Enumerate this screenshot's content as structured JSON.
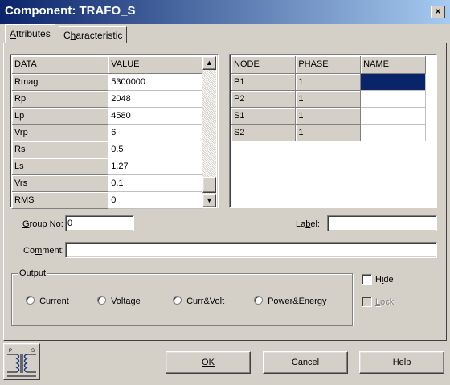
{
  "window": {
    "title": "Component: TRAFO_S",
    "close_label": "×"
  },
  "tabs": [
    {
      "label": "Attributes",
      "active": true
    },
    {
      "label": "Characteristic",
      "active": false
    }
  ],
  "data_grid": {
    "columns": [
      "DATA",
      "VALUE"
    ],
    "rows": [
      {
        "name": "Rmag",
        "value": "5300000"
      },
      {
        "name": "Rp",
        "value": "2048"
      },
      {
        "name": "Lp",
        "value": "4580"
      },
      {
        "name": "Vrp",
        "value": "6"
      },
      {
        "name": "Rs",
        "value": "0.5"
      },
      {
        "name": "Ls",
        "value": "1.27"
      },
      {
        "name": "Vrs",
        "value": "0.1"
      },
      {
        "name": "RMS",
        "value": "0"
      }
    ]
  },
  "node_grid": {
    "columns": [
      "NODE",
      "PHASE",
      "NAME"
    ],
    "rows": [
      {
        "node": "P1",
        "phase": "1",
        "name": ""
      },
      {
        "node": "P2",
        "phase": "1",
        "name": ""
      },
      {
        "node": "S1",
        "phase": "1",
        "name": ""
      },
      {
        "node": "S2",
        "phase": "1",
        "name": ""
      }
    ],
    "selection_color": "#0a246a"
  },
  "group_no": {
    "label": "Group No:",
    "value": "0"
  },
  "label_field": {
    "label": "Label:",
    "value": ""
  },
  "comment_field": {
    "label": "Comment:",
    "value": ""
  },
  "output": {
    "legend": "Output",
    "options": [
      "Current",
      "Voltage",
      "Curr&Volt",
      "Power&Energy"
    ]
  },
  "hide": {
    "label": "Hide",
    "checked": false
  },
  "lock": {
    "label": "Lock",
    "checked": false,
    "disabled": true
  },
  "icon": {
    "name": "transformer-icon",
    "pin_left": "P",
    "pin_right": "S"
  },
  "buttons": {
    "ok": "OK",
    "cancel": "Cancel",
    "help": "Help"
  }
}
